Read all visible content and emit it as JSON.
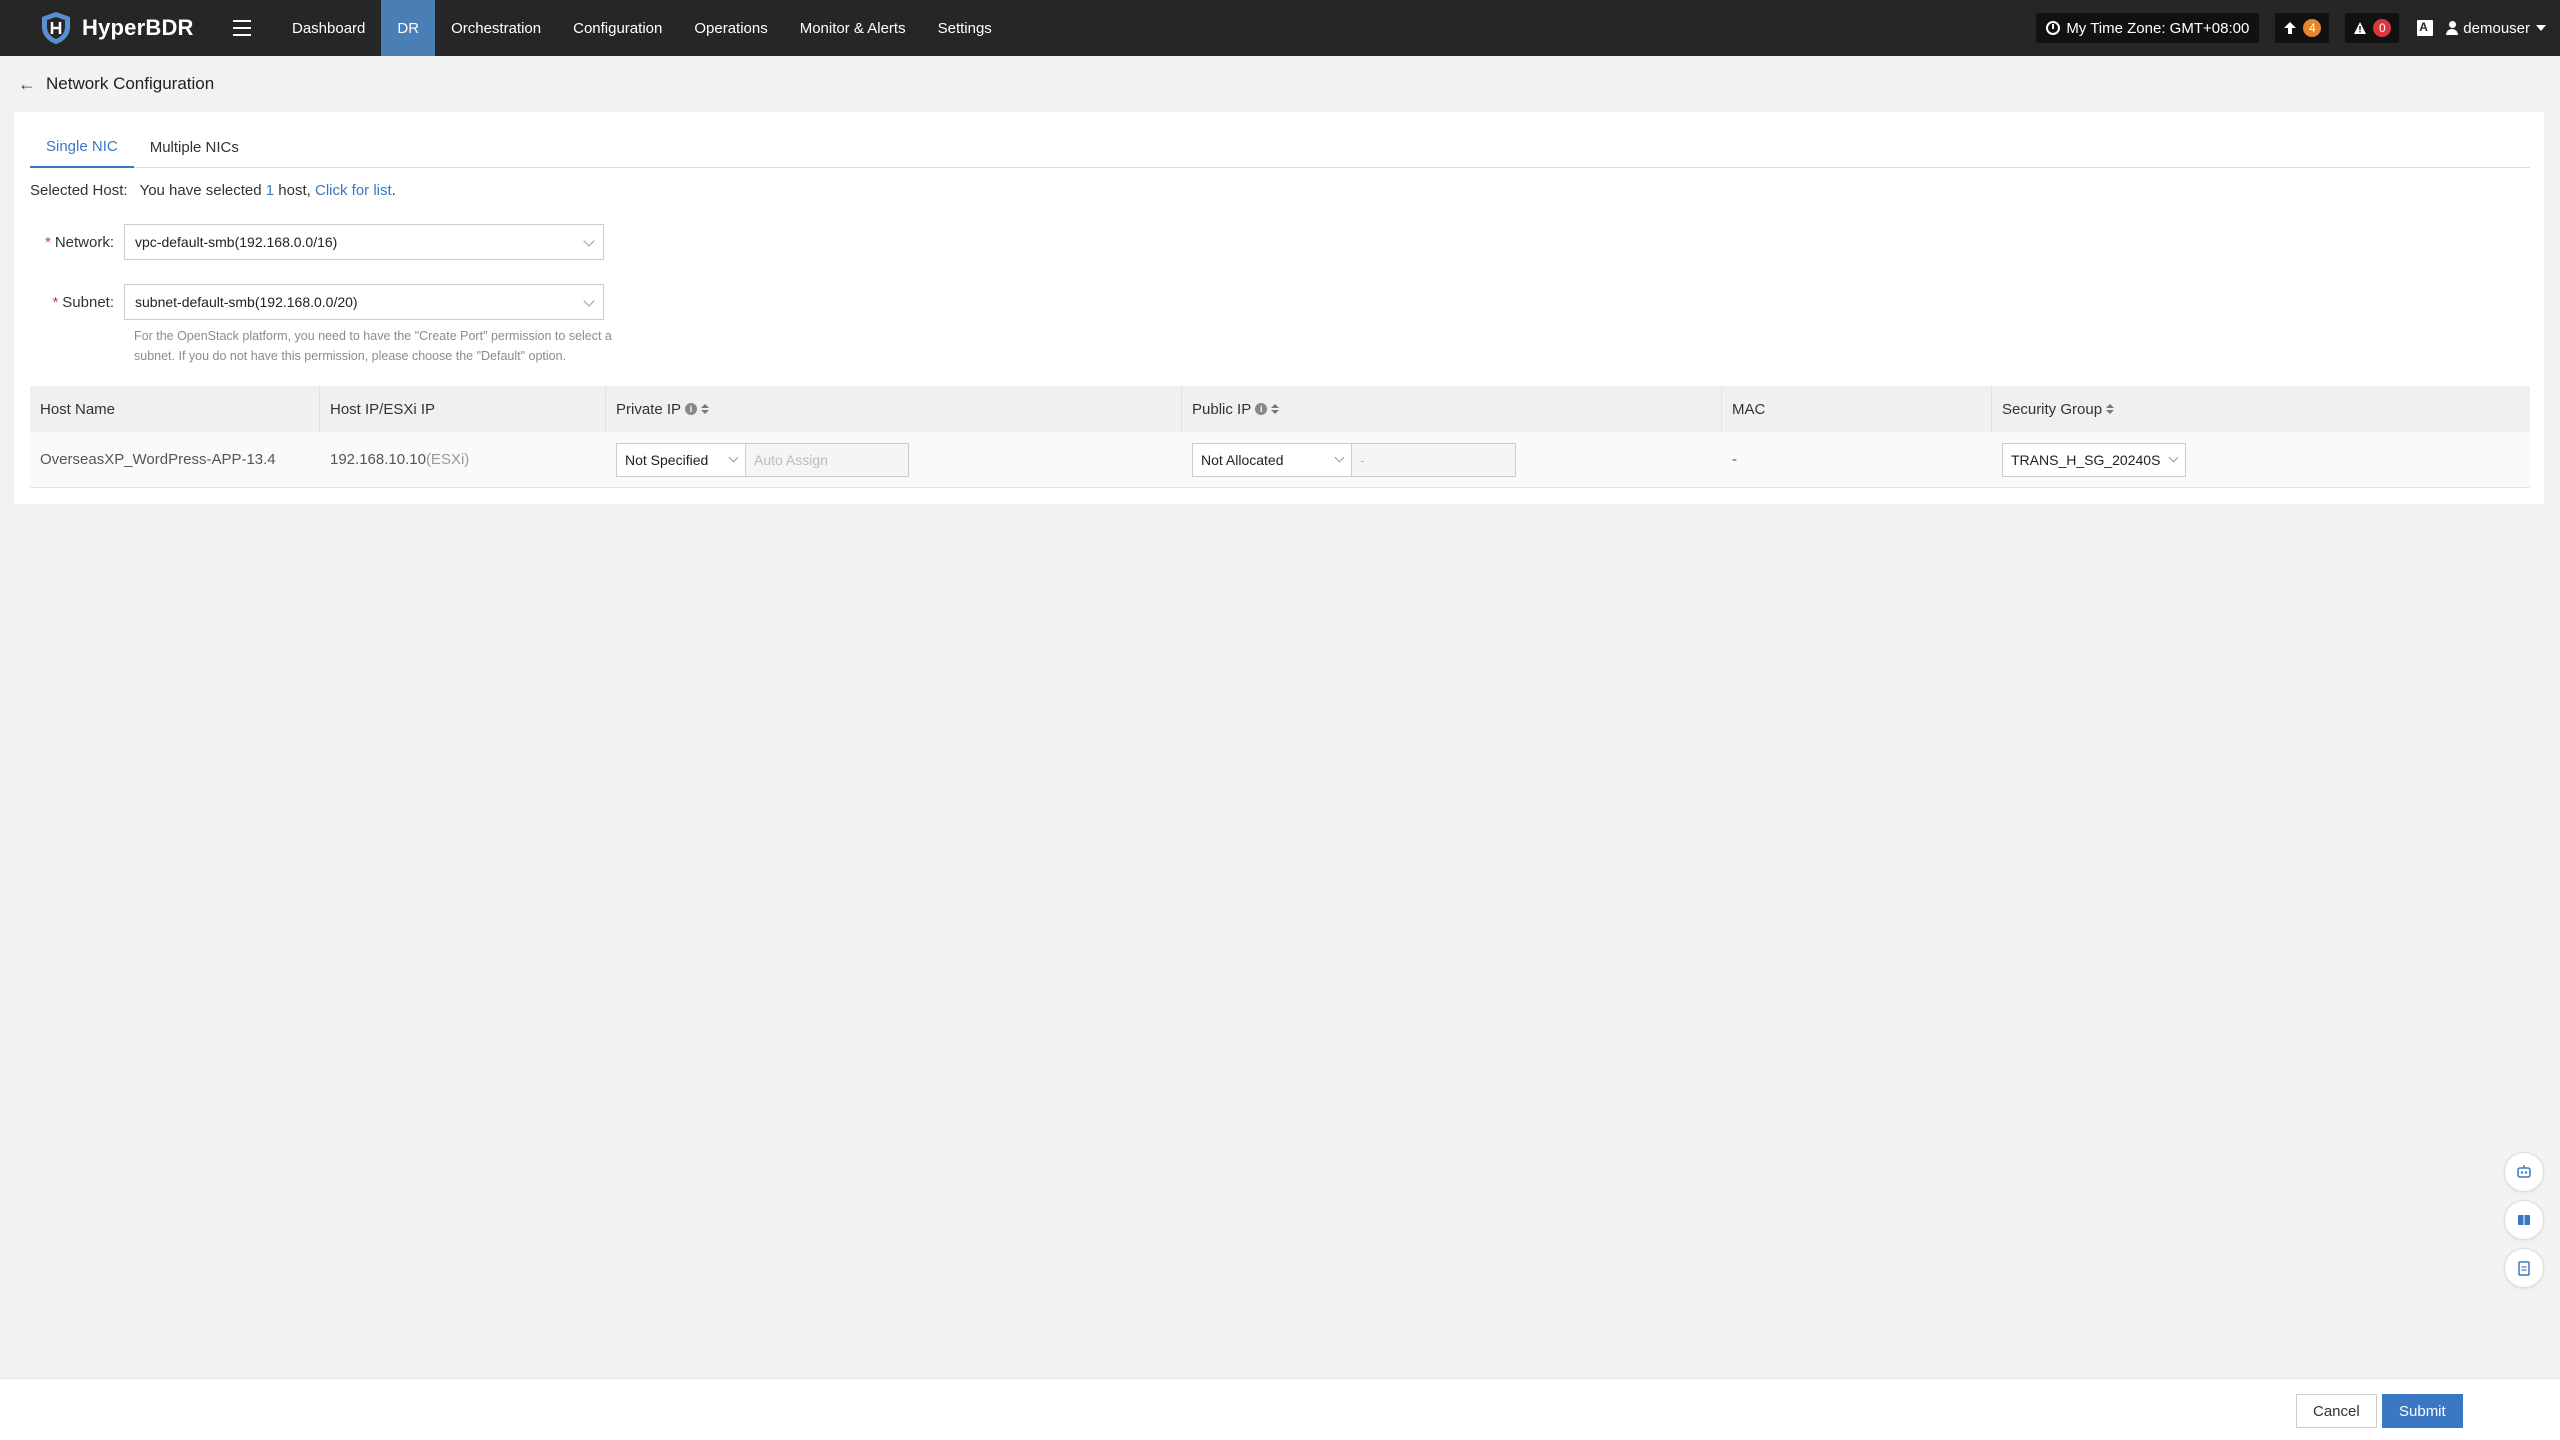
{
  "app": {
    "name": "HyperBDR"
  },
  "nav": {
    "items": [
      {
        "label": "Dashboard",
        "active": false
      },
      {
        "label": "DR",
        "active": true
      },
      {
        "label": "Orchestration",
        "active": false
      },
      {
        "label": "Configuration",
        "active": false
      },
      {
        "label": "Operations",
        "active": false
      },
      {
        "label": "Monitor & Alerts",
        "active": false
      },
      {
        "label": "Settings",
        "active": false
      }
    ]
  },
  "topbar": {
    "timezone": "My Time Zone: GMT+08:00",
    "upload_count": "4",
    "alert_count": "0",
    "username": "demouser"
  },
  "page": {
    "title": "Network Configuration"
  },
  "tabs": [
    {
      "label": "Single NIC",
      "active": true
    },
    {
      "label": "Multiple NICs",
      "active": false
    }
  ],
  "selected_host": {
    "label": "Selected Host:",
    "text_prefix": "You have selected ",
    "count": "1",
    "text_mid": " host, ",
    "link": "Click for list",
    "text_suffix": "."
  },
  "form": {
    "network": {
      "label": "Network:",
      "value": "vpc-default-smb(192.168.0.0/16)"
    },
    "subnet": {
      "label": "Subnet:",
      "value": "subnet-default-smb(192.168.0.0/20)"
    },
    "hint": "For the OpenStack platform, you need to have the \"Create Port\" permission to select a subnet. If you do not have this permission, please choose the \"Default\" option."
  },
  "table": {
    "columns": [
      "Host Name",
      "Host IP/ESXi IP",
      "Private IP",
      "Public IP",
      "MAC",
      "Security Group"
    ],
    "rows": [
      {
        "host_name": "OverseasXP_WordPress-APP-13.4",
        "host_ip": "192.168.10.10",
        "host_ip_suffix": "(ESXi)",
        "private_ip_mode": "Not Specified",
        "private_ip_placeholder": "Auto Assign",
        "public_ip_mode": "Not Allocated",
        "public_ip_value": "-",
        "mac": "-",
        "security_group": "TRANS_H_SG_20240S"
      }
    ]
  },
  "footer": {
    "cancel": "Cancel",
    "submit": "Submit"
  },
  "colors": {
    "accent": "#3a78c3",
    "topbar": "#262626",
    "nav_active": "#4a7fb6",
    "badge_orange": "#e6862c",
    "badge_red": "#d9363e"
  },
  "icons": [
    "back-arrow-icon",
    "clock-icon",
    "upload-icon",
    "warning-icon",
    "language-icon",
    "user-icon",
    "info-icon",
    "sort-icon",
    "robot-icon",
    "book-icon",
    "clipboard-icon"
  ]
}
